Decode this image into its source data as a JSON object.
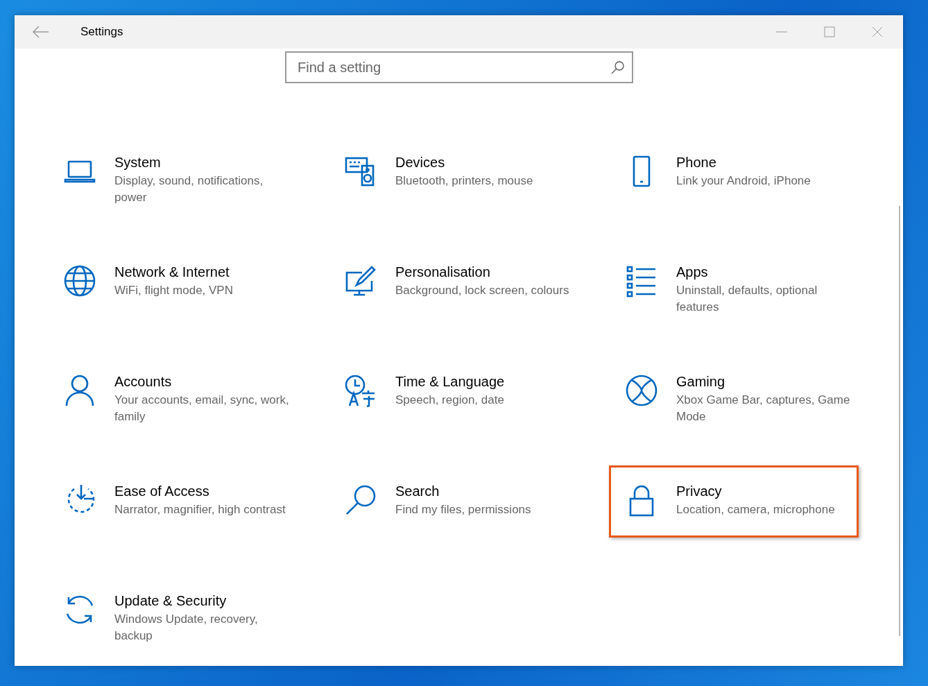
{
  "window": {
    "title": "Settings"
  },
  "search": {
    "placeholder": "Find a setting"
  },
  "tiles": [
    {
      "title": "System",
      "description": "Display, sound, notifications, power",
      "highlighted": false
    },
    {
      "title": "Devices",
      "description": "Bluetooth, printers, mouse",
      "highlighted": false
    },
    {
      "title": "Phone",
      "description": "Link your Android, iPhone",
      "highlighted": false
    },
    {
      "title": "Network & Internet",
      "description": "WiFi, flight mode, VPN",
      "highlighted": false
    },
    {
      "title": "Personalisation",
      "description": "Background, lock screen, colours",
      "highlighted": false
    },
    {
      "title": "Apps",
      "description": "Uninstall, defaults, optional features",
      "highlighted": false
    },
    {
      "title": "Accounts",
      "description": "Your accounts, email, sync, work, family",
      "highlighted": false
    },
    {
      "title": "Time & Language",
      "description": "Speech, region, date",
      "highlighted": false
    },
    {
      "title": "Gaming",
      "description": "Xbox Game Bar, captures, Game Mode",
      "highlighted": false
    },
    {
      "title": "Ease of Access",
      "description": "Narrator, magnifier, high contrast",
      "highlighted": false
    },
    {
      "title": "Search",
      "description": "Find my files, permissions",
      "highlighted": false
    },
    {
      "title": "Privacy",
      "description": "Location, camera, microphone",
      "highlighted": true
    },
    {
      "title": "Update & Security",
      "description": "Windows Update, recovery, backup",
      "highlighted": false
    }
  ]
}
